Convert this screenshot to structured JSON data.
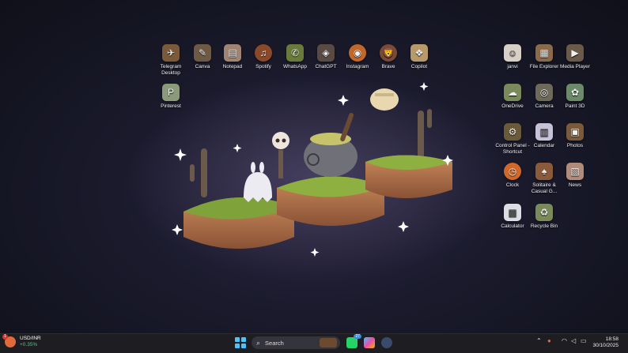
{
  "desktop": {
    "icons_top": [
      {
        "label": "Telegram Desktop",
        "icon": "telegram-icon"
      },
      {
        "label": "Canva",
        "icon": "canva-icon"
      },
      {
        "label": "Notepad",
        "icon": "notepad-icon"
      },
      {
        "label": "Spotify",
        "icon": "spotify-icon"
      },
      {
        "label": "WhatsApp",
        "icon": "whatsapp-icon"
      },
      {
        "label": "ChatGPT",
        "icon": "chatgpt-icon"
      },
      {
        "label": "Instagram",
        "icon": "instagram-icon"
      },
      {
        "label": "Brave",
        "icon": "brave-icon"
      },
      {
        "label": "Copilot",
        "icon": "copilot-icon"
      }
    ],
    "icons_left_second": [
      {
        "label": "Pinterest",
        "icon": "pinterest-icon"
      }
    ],
    "icons_right": [
      {
        "label": "janvi",
        "icon": "user-folder-icon"
      },
      {
        "label": "File Explorer",
        "icon": "file-explorer-icon"
      },
      {
        "label": "Media Player",
        "icon": "media-player-icon"
      },
      {
        "label": "OneDrive",
        "icon": "onedrive-icon"
      },
      {
        "label": "Camera",
        "icon": "camera-icon"
      },
      {
        "label": "Paint 3D",
        "icon": "paint-3d-icon"
      },
      {
        "label": "Control Panel - Shortcut",
        "icon": "control-panel-icon"
      },
      {
        "label": "Calendar",
        "icon": "calendar-icon"
      },
      {
        "label": "Photos",
        "icon": "photos-icon"
      },
      {
        "label": "Clock",
        "icon": "clock-icon"
      },
      {
        "label": "Solitaire & Casual G...",
        "icon": "solitaire-icon"
      },
      {
        "label": "News",
        "icon": "news-icon"
      },
      {
        "label": "Calculator",
        "icon": "calculator-icon"
      },
      {
        "label": "Recycle Bin",
        "icon": "recycle-bin-icon"
      }
    ]
  },
  "taskbar": {
    "widget": {
      "badge": "1",
      "symbol": "USD/INR",
      "change": "+0.35%"
    },
    "search_placeholder": "Search",
    "whatsapp_badge": "27",
    "clock": {
      "time": "18:58",
      "date": "30/10/2025"
    },
    "accent": "#4cc2ff"
  }
}
